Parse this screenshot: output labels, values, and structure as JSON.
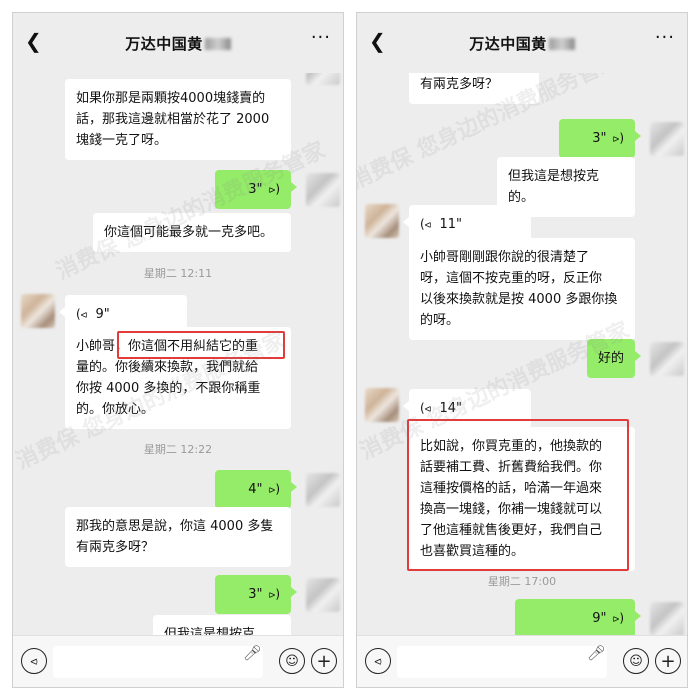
{
  "left": {
    "title": "万达中国黄",
    "top_bubble": [
      "如果你那是兩顆按4000塊錢賣的",
      "話，那我這邊就相當於花了 2000",
      "塊錢一克了呀。"
    ],
    "voice1": "3\"",
    "reply1": "你這個可能最多就一克多吧。",
    "time1": "星期二 12:11",
    "voice2": "9\"",
    "msg2": [
      "小帥哥，你這個不用糾結它的重",
      "量的。你後續來換款，我們就給",
      "你按 4000 多換的，不跟你稱重",
      "的。你放心。"
    ],
    "time2": "星期二 12:22",
    "voice3": "4\"",
    "msg3": [
      "那我的意思是說，你這 4000 多隻",
      "有兩克多呀？"
    ],
    "voice4": "3\"",
    "msg4": "但我這是想按克的。"
  },
  "right": {
    "title": "万达中国黄",
    "top_text": "有兩克多呀？",
    "voice1": "3\"",
    "msg1": "但我這是想按克的。",
    "voice2": "11\"",
    "msg2": [
      "小帥哥剛剛跟你說的很清楚了",
      "呀，這個不按克重的呀，反正你",
      "以後來換款就是按 4000 多跟你換",
      "的呀。"
    ],
    "reply2": "好的",
    "voice3": "14\"",
    "msg3": [
      "比如說，你買克重的，他換款的",
      "話要補工費、折舊費給我們。你",
      "這種按價格的話，哈滿一年過來",
      "換高一塊錢，你補一塊錢就可以",
      "了他這種就售後更好，我們自己",
      "也喜歡買這種的。"
    ],
    "time3": "星期二 17:00",
    "voice4": "9\""
  },
  "watermark": "消费保 您身边的消费服务管家",
  "icons": {
    "back": "chevron-left-icon",
    "more": "more-icon",
    "voice": "voice-wave-icon",
    "input_voice": "voice-input-icon",
    "mic": "mic-icon",
    "emoji": "emoji-icon",
    "plus": "plus-icon"
  },
  "colors": {
    "sent_bubble": "#95ec69",
    "highlight": "#e33b3b"
  }
}
